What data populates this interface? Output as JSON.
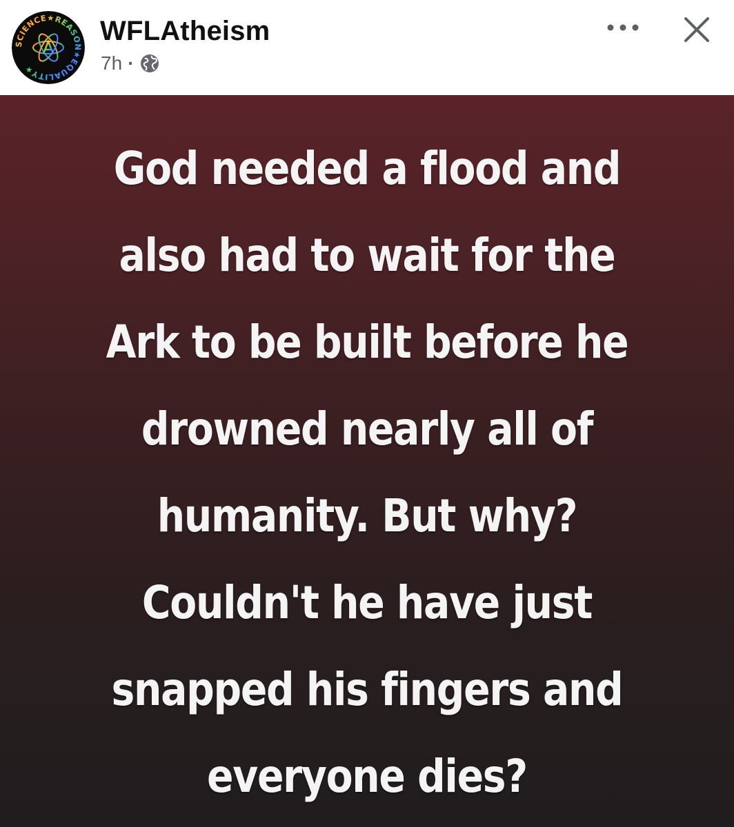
{
  "post": {
    "page_name": "WFLAtheism",
    "time_ago": "7h",
    "separator": "·",
    "privacy_icon": "globe-icon",
    "more_icon": "more-dots-icon",
    "close_icon": "close-icon",
    "avatar": {
      "icon": "atom-icon",
      "ring_text": "SCIENCE★REASON★EQUALITY★"
    }
  },
  "image": {
    "lines": [
      "God needed a flood and",
      "also had to wait for the",
      "Ark to be built before he",
      "drowned nearly all of",
      "humanity. But why?",
      "Couldn't he have just",
      "snapped his fingers and",
      "everyone dies?"
    ]
  },
  "colors": {
    "background": "#ffffff",
    "name_text": "#111111",
    "meta_text": "#5c5f64",
    "image_top": "#5a2328",
    "image_bottom": "#201d1e",
    "image_text": "#f4f4f4"
  }
}
